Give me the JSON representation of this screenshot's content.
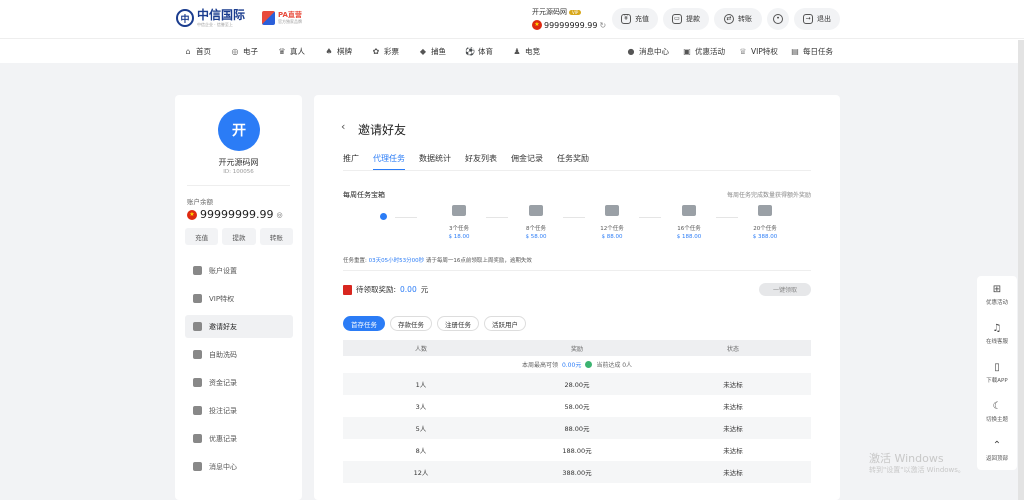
{
  "logo": {
    "name": "中信国际",
    "tag": "中信企业 · 信誉至上",
    "pa_title": "PA直营",
    "pa_sub": "官方独家品牌"
  },
  "user": {
    "name": "开元源码网",
    "vip": "VIP",
    "balance": "99999999.99"
  },
  "top_buttons": {
    "deposit": "充值",
    "withdraw": "提款",
    "transfer": "转账",
    "logout": "退出"
  },
  "nav": {
    "items": [
      "首页",
      "电子",
      "真人",
      "棋牌",
      "彩票",
      "捕鱼",
      "体育",
      "电竞"
    ],
    "right": [
      "消息中心",
      "优惠活动",
      "VIP特权",
      "每日任务"
    ]
  },
  "sidebar": {
    "avatar": "开",
    "name": "开元源码网",
    "id": "ID: 100056",
    "balance_label": "账户余额",
    "balance": "99999999.99",
    "buttons": [
      "充值",
      "提款",
      "转账"
    ],
    "menu": [
      "账户设置",
      "VIP特权",
      "邀请好友",
      "自助洗码",
      "资金记录",
      "投注记录",
      "优惠记录",
      "消息中心"
    ]
  },
  "main": {
    "title": "邀请好友",
    "tabs": [
      "推广",
      "代理任务",
      "数据统计",
      "好友列表",
      "佣金记录",
      "任务奖励"
    ],
    "weekly_title": "每周任务宝箱",
    "weekly_hint": "每周任务完成数量获得额外奖励",
    "steps": [
      {
        "count": "3个任务",
        "reward": "18.00"
      },
      {
        "count": "8个任务",
        "reward": "58.00"
      },
      {
        "count": "12个任务",
        "reward": "88.00"
      },
      {
        "count": "16个任务",
        "reward": "188.00"
      },
      {
        "count": "20个任务",
        "reward": "388.00"
      }
    ],
    "reset_prefix": "任务重置: ",
    "reset_time": "03天05小时53分00秒",
    "reset_suffix": "   请于每周一16点前领取上周奖励，逾期失效",
    "pending_label": "待领取奖励: ",
    "pending_amount": "0.00",
    "pending_unit": "元",
    "claim_btn": "一键领取",
    "filter_tabs": [
      "首存任务",
      "存款任务",
      "注册任务",
      "活跃用户"
    ],
    "table": {
      "headers": [
        "人数",
        "奖励",
        "状态"
      ],
      "summary_a": "本周最高可领",
      "summary_amount": "0.00元",
      "summary_b": "当前达成 0人",
      "rows": [
        {
          "people": "1人",
          "reward": "28.00元",
          "status": "未达标"
        },
        {
          "people": "3人",
          "reward": "58.00元",
          "status": "未达标"
        },
        {
          "people": "5人",
          "reward": "88.00元",
          "status": "未达标"
        },
        {
          "people": "8人",
          "reward": "188.00元",
          "status": "未达标"
        },
        {
          "people": "12人",
          "reward": "388.00元",
          "status": "未达标"
        }
      ]
    }
  },
  "float": [
    "优惠活动",
    "在线客服",
    "下载APP",
    "切换主题",
    "返回顶部"
  ],
  "watermark": {
    "line1": "激活 Windows",
    "line2": "转到\"设置\"以激活 Windows。"
  }
}
